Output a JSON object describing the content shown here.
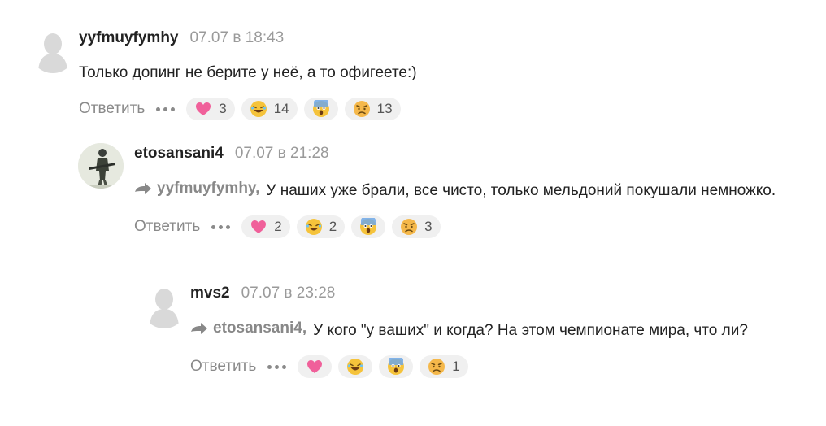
{
  "comments": [
    {
      "author": "yyfmuyfymhy",
      "time": "07.07 в 18:43",
      "reply_to": "",
      "text": "Только допинг не берите у неё, а то офигеете:)",
      "reply_label": "Ответить",
      "reactions": [
        {
          "icon": "heart-icon",
          "count": "3"
        },
        {
          "icon": "laughing-icon",
          "count": "14"
        },
        {
          "icon": "shocked-icon",
          "count": ""
        },
        {
          "icon": "sad-icon",
          "count": "13"
        }
      ]
    },
    {
      "author": "etosansani4",
      "time": "07.07 в 21:28",
      "reply_to": "yyfmuyfymhy,",
      "text": "У наших уже брали, все чисто, только мельдоний покушали немножко.",
      "reply_label": "Ответить",
      "reactions": [
        {
          "icon": "heart-icon",
          "count": "2"
        },
        {
          "icon": "laughing-icon",
          "count": "2"
        },
        {
          "icon": "shocked-icon",
          "count": ""
        },
        {
          "icon": "sad-icon",
          "count": "3"
        }
      ]
    },
    {
      "author": "mvs2",
      "time": "07.07 в 23:28",
      "reply_to": "etosansani4,",
      "text": "У кого \"у ваших\" и когда? На этом чемпионате мира, что ли?",
      "reply_label": "Ответить",
      "reactions": [
        {
          "icon": "heart-icon",
          "count": ""
        },
        {
          "icon": "laughing-icon",
          "count": ""
        },
        {
          "icon": "shocked-icon",
          "count": ""
        },
        {
          "icon": "sad-icon",
          "count": "1"
        }
      ]
    }
  ],
  "colors": {
    "accent_heart": "#f0609a",
    "emoji_yellow": "#f5c33b",
    "muted": "#8a8a8a"
  }
}
